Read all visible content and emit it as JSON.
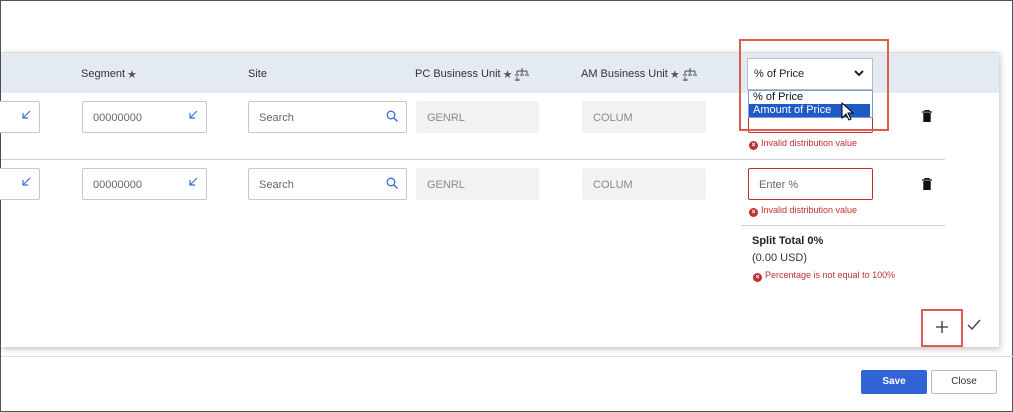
{
  "columns": {
    "segment": "Segment",
    "site": "Site",
    "pc_business_unit": "PC Business Unit",
    "am_business_unit": "AM Business Unit"
  },
  "distribution_select": {
    "value": "% of Price",
    "options": [
      "% of Price",
      "Amount of Price"
    ],
    "highlighted": "Amount of Price"
  },
  "rows": [
    {
      "segment": "00000000",
      "site_placeholder": "Search",
      "pc_business_unit": "GENRL",
      "am_business_unit": "COLUM",
      "amount_placeholder": "",
      "error": "Invalid distribution value"
    },
    {
      "segment": "00000000",
      "site_placeholder": "Search",
      "pc_business_unit": "GENRL",
      "am_business_unit": "COLUM",
      "amount_placeholder": "Enter %",
      "error": "Invalid distribution value"
    }
  ],
  "split_total": {
    "title": "Split Total 0%",
    "subtitle": "(0.00 USD)",
    "error": "Percentage is not equal to 100%"
  },
  "footer": {
    "save_label": "Save",
    "close_label": "Close"
  },
  "colors": {
    "header_band": "#e3eaf2",
    "error": "#c0302f",
    "primary": "#2f63d6",
    "highlight": "#e05a4e"
  }
}
